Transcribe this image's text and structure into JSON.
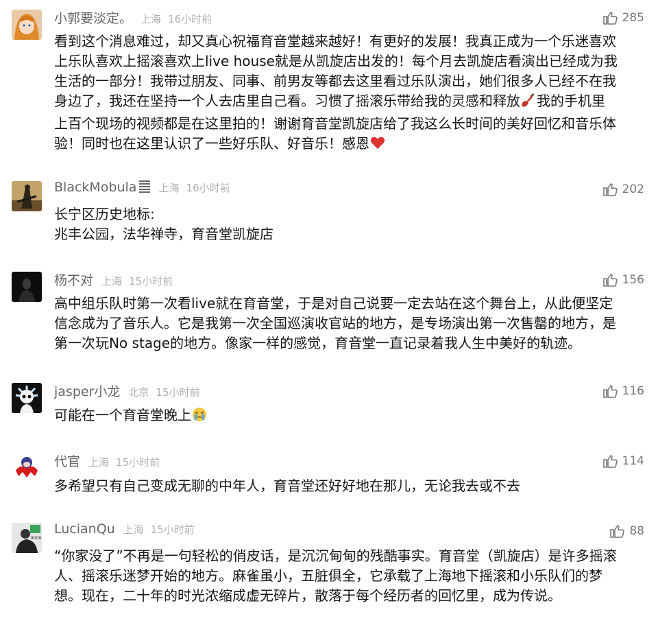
{
  "comments": [
    {
      "username": "小郭要淡定。",
      "location": "上海",
      "time": "16小时前",
      "likes": "285",
      "lines": [
        "看到这个消息难过，却又真心祝福育音堂越来越好！有更好的发展！我真正成为一个乐迷喜欢",
        "上乐队喜欢上摇滚喜欢上live house就是从凯旋店出发的！每个月去凯旋店看演出已经成为我",
        "生活的一部分！我带过朋友、同事、前男友等都去这里看过乐队演出，她们很多人已经不在我",
        "身边了，我还在坚持一个人去店里自己看。习惯了摇滚乐带给我的灵感和释放",
        "我的手机里",
        "上百个现场的视频都是在这里拍的！谢谢育音堂凯旋店给了我这么长时间的美好回忆和音乐体",
        "验！同时也在这里认识了一些好乐队、好音乐！感恩"
      ]
    },
    {
      "username": "BlackMobula",
      "location": "上海",
      "time": "16小时前",
      "likes": "202",
      "lines": [
        "长宁区历史地标:",
        "兆丰公园，法华禅寺，育音堂凯旋店"
      ]
    },
    {
      "username": "杨不对",
      "location": "上海",
      "time": "15小时前",
      "likes": "156",
      "lines": [
        "高中组乐队时第一次看live就在育音堂，于是对自己说要一定去站在这个舞台上，从此便坚定",
        "信念成为了音乐人。它是我第一次全国巡演收官站的地方，是专场演出第一次售罄的地方，是",
        "第一次玩No stage的地方。像家一样的感觉，育音堂一直记录着我人生中美好的轨迹。"
      ]
    },
    {
      "username": "jasper小龙",
      "location": "北京",
      "time": "15小时前",
      "likes": "116",
      "lines": [
        "可能在一个育音堂晚上"
      ]
    },
    {
      "username": "代官",
      "location": "上海",
      "time": "15小时前",
      "likes": "114",
      "lines": [
        "多希望只有自己变成无聊的中年人，育音堂还好好地在那儿，无论我去或不去"
      ]
    },
    {
      "username": "LucianQu",
      "location": "上海",
      "time": "15小时前",
      "likes": "88",
      "lines": [
        "“你家没了”不再是一句轻松的俏皮话，是沉沉甸甸的残酷事实。育音堂（凯旋店）是许多摇滚",
        "人、摇滚乐迷梦开始的地方。麻雀虽小，五脏俱全，它承载了上海地下摇滚和小乐队们的梦",
        "想。现在，二十年的时光浓缩成虚无碎片，散落于每个经历者的回忆里，成为传说。"
      ]
    }
  ],
  "avatar_badge": "8008"
}
